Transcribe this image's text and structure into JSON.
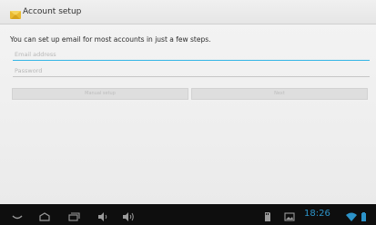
{
  "window": {
    "title": "Account setup"
  },
  "form": {
    "instructions": "You can set up email for most accounts in just a few steps.",
    "email_placeholder": "Email address",
    "email_value": "",
    "password_placeholder": "Password",
    "password_value": "",
    "manual_setup_label": "Manual setup",
    "next_label": "Next"
  },
  "status_bar": {
    "time": "18:26"
  },
  "icons": {
    "app": "email-app-icon",
    "nav": [
      "back-icon",
      "home-icon",
      "recent-apps-icon",
      "volume-down-icon",
      "volume-up-icon"
    ],
    "status": [
      "sd-card-icon",
      "screenshot-icon",
      "wifi-icon",
      "battery-icon"
    ]
  },
  "colors": {
    "accent": "#33b5e5",
    "clock": "#2c93c9",
    "navbar_bg": "#0e0e0e"
  }
}
